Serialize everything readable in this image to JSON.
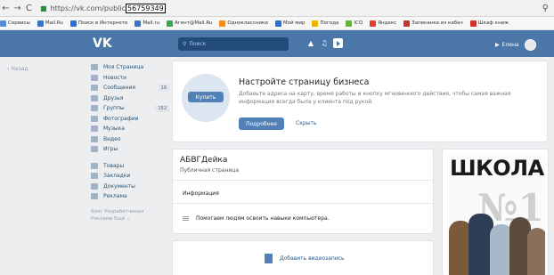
{
  "browser": {
    "url_prefix": "https://vk.com/public",
    "url_id": "56759349",
    "back_glyph": "←",
    "fwd_glyph": "→",
    "reload_glyph": "C",
    "lock_glyph": "🔒",
    "key_glyph": "⚲"
  },
  "bookmarks": [
    {
      "label": "Сервисы",
      "color": "#5b8dd6"
    },
    {
      "label": "Mail.Ru",
      "color": "#3b73c7"
    },
    {
      "label": "Поиск в Интернете",
      "color": "#2a6fd6"
    },
    {
      "label": "Mail.ru",
      "color": "#3b73c7"
    },
    {
      "label": "Агент@Mail.Ru",
      "color": "#37a849"
    },
    {
      "label": "Одноклассники",
      "color": "#f08c1c"
    },
    {
      "label": "Мой мир",
      "color": "#2a6fd6"
    },
    {
      "label": "Погода",
      "color": "#f0b400"
    },
    {
      "label": "ICQ",
      "color": "#63b33a"
    },
    {
      "label": "Яндекс",
      "color": "#e23f2d"
    },
    {
      "label": "Запеканка из кабач",
      "color": "#c0392b"
    },
    {
      "label": "Шкаф книж",
      "color": "#d32f2f"
    }
  ],
  "header": {
    "logo": "VK",
    "search_placeholder": "Поиск",
    "user_name": "Елена"
  },
  "back_link": "Назад",
  "menu": [
    {
      "label": "Моя Страница",
      "count": ""
    },
    {
      "label": "Новости",
      "count": ""
    },
    {
      "label": "Сообщения",
      "count": "19"
    },
    {
      "label": "Друзья",
      "count": ""
    },
    {
      "label": "Группы",
      "count": "152"
    },
    {
      "label": "Фотографии",
      "count": ""
    },
    {
      "label": "Музыка",
      "count": ""
    },
    {
      "label": "Видео",
      "count": ""
    },
    {
      "label": "Игры",
      "count": ""
    }
  ],
  "menu2": [
    {
      "label": "Товары"
    },
    {
      "label": "Закладки"
    },
    {
      "label": "Документы"
    },
    {
      "label": "Реклама"
    }
  ],
  "menu_footer": [
    "Блог  Разработчикам",
    "Реклама  Ещё ⌄"
  ],
  "business": {
    "buy_button": "Купить",
    "title": "Настройте страницу бизнеса",
    "description": "Добавьте адреса на карту, время работы и кнопку мгновенного действия, чтобы самая важная информация всегда была у клиента под рукой.",
    "more_button": "Подробнее",
    "hide_link": "Скрыть"
  },
  "page": {
    "name": "АБВГДейка",
    "type": "Публичная страница",
    "info_label": "Информация",
    "status": "Помогаем людям освоить навыки компьютера."
  },
  "video": {
    "add_label": "Добавить видеозапись"
  },
  "poster": {
    "title": "ШКОЛА",
    "number": "№1"
  }
}
